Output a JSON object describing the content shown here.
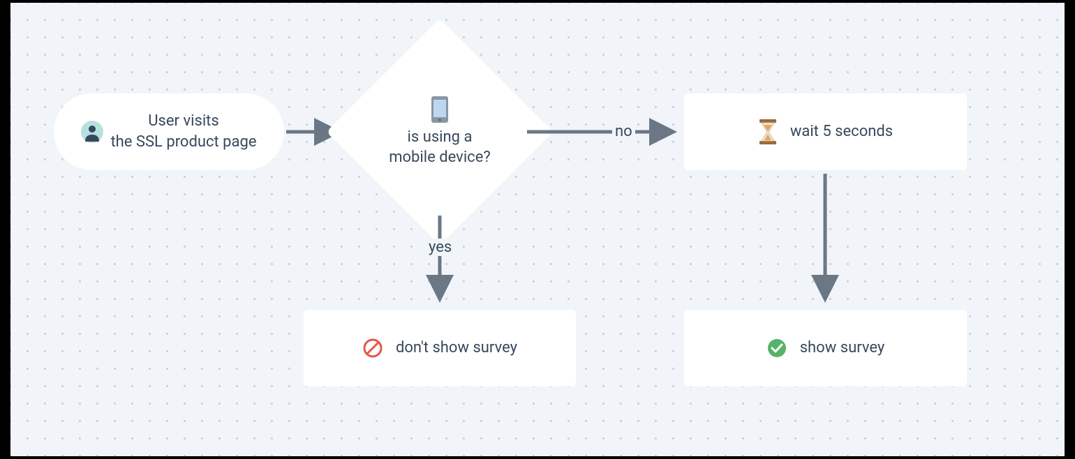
{
  "nodes": {
    "start": {
      "text": "User visits\nthe SSL product page",
      "icon": "user-icon"
    },
    "decision": {
      "text": "is using a\nmobile device?",
      "icon": "mobile-icon"
    },
    "wait": {
      "text": "wait 5 seconds",
      "icon": "hourglass-icon"
    },
    "dont_show": {
      "text": "don't show survey",
      "icon": "prohibit-icon"
    },
    "show": {
      "text": "show survey",
      "icon": "check-icon"
    }
  },
  "edges": {
    "no_label": "no",
    "yes_label": "yes"
  },
  "colors": {
    "text": "#37485c",
    "arrow": "#6b7785",
    "canvas": "#f1f5f9",
    "dot": "#c8d0da",
    "user_bg": "#b6e0dd",
    "user_fg": "#37485c",
    "mobile_screen": "#bcd8f0",
    "mobile_body": "#8a97a3",
    "hourglass_frame": "#9a6b3a",
    "hourglass_sand": "#e9a45a",
    "prohibit": "#e2574c",
    "check_bg": "#57b36a"
  }
}
